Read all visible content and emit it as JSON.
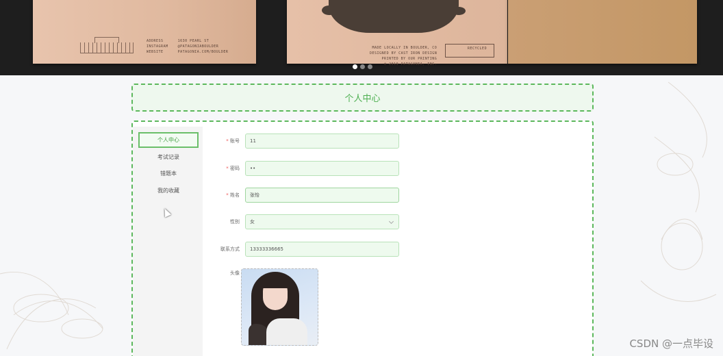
{
  "banner": {
    "card_left_text": "ADDRESS      1630 PEARL ST\nINSTAGRAM    @PATAGONIABOULDER\nWEBSITE      PATAGONIA.COM/BOULDER",
    "card_mid_text": "MADE LOCALLY IN BOULDER, CO\nDESIGNED BY CAST IRON DESIGN\nPRINTED BY OUR PRINTING\n© 2019 PATAGONIA, INC.",
    "recycle_text": "RECYCLED",
    "carousel_dots": 3,
    "active_dot": 0
  },
  "title": "个人中心",
  "sidebar": {
    "items": [
      {
        "label": "个人中心",
        "active": true
      },
      {
        "label": "考试记录",
        "active": false
      },
      {
        "label": "错题本",
        "active": false
      },
      {
        "label": "我的收藏",
        "active": false
      }
    ]
  },
  "form": {
    "account": {
      "label": "账号",
      "required": true,
      "value": "11"
    },
    "password": {
      "label": "密码",
      "required": true,
      "value": "••"
    },
    "name": {
      "label": "姓名",
      "required": true,
      "value": "张怡"
    },
    "gender": {
      "label": "性别",
      "required": false,
      "value": "女"
    },
    "contact": {
      "label": "联系方式",
      "required": false,
      "value": "13333336665"
    },
    "avatar": {
      "label": "头像"
    }
  },
  "watermark": "CSDN @一点毕设",
  "colors": {
    "accent": "#5cb85c",
    "field_bg": "#eefaee",
    "banner_bg": "#1e1e1e"
  }
}
